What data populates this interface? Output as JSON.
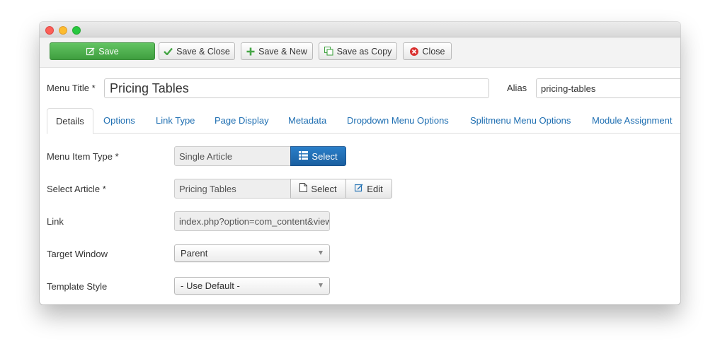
{
  "toolbar": {
    "save": "Save",
    "save_close": "Save & Close",
    "save_new": "Save & New",
    "save_copy": "Save as Copy",
    "close": "Close"
  },
  "form": {
    "menu_title_label": "Menu Title *",
    "menu_title_value": "Pricing Tables",
    "alias_label": "Alias",
    "alias_value": "pricing-tables"
  },
  "tabs": [
    {
      "label": "Details"
    },
    {
      "label": "Options"
    },
    {
      "label": "Link Type"
    },
    {
      "label": "Page Display"
    },
    {
      "label": "Metadata"
    },
    {
      "label": "Dropdown Menu Options"
    },
    {
      "label": "Splitmenu Menu Options"
    },
    {
      "label": "Module Assignment"
    }
  ],
  "details": {
    "menu_item_type_label": "Menu Item Type *",
    "menu_item_type_value": "Single Article",
    "menu_item_type_button": "Select",
    "select_article_label": "Select Article *",
    "select_article_value": "Pricing Tables",
    "select_article_select_button": "Select",
    "select_article_edit_button": "Edit",
    "link_label": "Link",
    "link_value": "index.php?option=com_content&view",
    "target_window_label": "Target Window",
    "target_window_value": "Parent",
    "template_style_label": "Template Style",
    "template_style_value": "- Use Default -"
  },
  "colors": {
    "save_green": "#46a546",
    "primary_blue": "#1f6fb2",
    "tab_link": "#1f6fb2"
  }
}
